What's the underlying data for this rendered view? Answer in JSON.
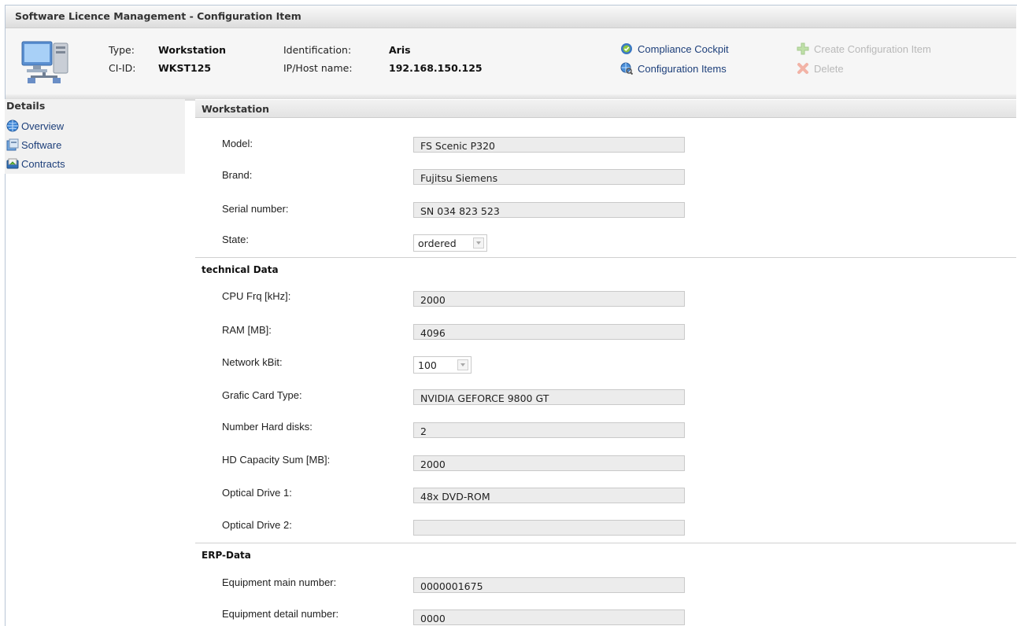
{
  "window": {
    "title": "Software Licence Management - Configuration Item"
  },
  "header": {
    "type_label": "Type:",
    "type_value": "Workstation",
    "ciid_label": "CI-ID:",
    "ciid_value": "WKST125",
    "identification_label": "Identification:",
    "identification_value": "Aris",
    "ip_label": "IP/Host name:",
    "ip_value": "192.168.150.125",
    "links": {
      "compliance_cockpit": "Compliance Cockpit",
      "configuration_items": "Configuration Items",
      "create_ci": "Create Configuration Item",
      "delete": "Delete"
    },
    "icon": "workstation-computer-icon"
  },
  "sidebar": {
    "title": "Details",
    "items": [
      {
        "label": "Overview",
        "icon": "globe-icon"
      },
      {
        "label": "Software",
        "icon": "software-icon"
      },
      {
        "label": "Contracts",
        "icon": "contracts-icon"
      }
    ]
  },
  "main": {
    "section_title": "Workstation",
    "fields": {
      "model_label": "Model:",
      "model_value": "FS Scenic P320",
      "brand_label": "Brand:",
      "brand_value": "Fujitsu Siemens",
      "serial_label": "Serial number:",
      "serial_value": "SN 034 823 523",
      "state_label": "State:",
      "state_value": "ordered"
    },
    "technical": {
      "title": "technical Data",
      "cpu_label": "CPU Frq [kHz]:",
      "cpu_value": "2000",
      "ram_label": "RAM [MB]:",
      "ram_value": "4096",
      "network_label": "Network kBit:",
      "network_value": "100",
      "grafic_label": "Grafic Card Type:",
      "grafic_value": "NVIDIA GEFORCE 9800 GT",
      "disks_label": "Number Hard disks:",
      "disks_value": "2",
      "hdcap_label": "HD Capacity Sum [MB]:",
      "hdcap_value": "2000",
      "od1_label": "Optical Drive 1:",
      "od1_value": "48x DVD-ROM",
      "od2_label": "Optical Drive 2:",
      "od2_value": ""
    },
    "erp": {
      "title": "ERP-Data",
      "main_label": "Equipment main number:",
      "main_value": "0000001675",
      "detail_label": "Equipment detail number:",
      "detail_value": "0000"
    }
  },
  "colors": {
    "link": "#1d3f7a",
    "disabled": "#b9b9b9",
    "field_bg": "#ececec"
  }
}
